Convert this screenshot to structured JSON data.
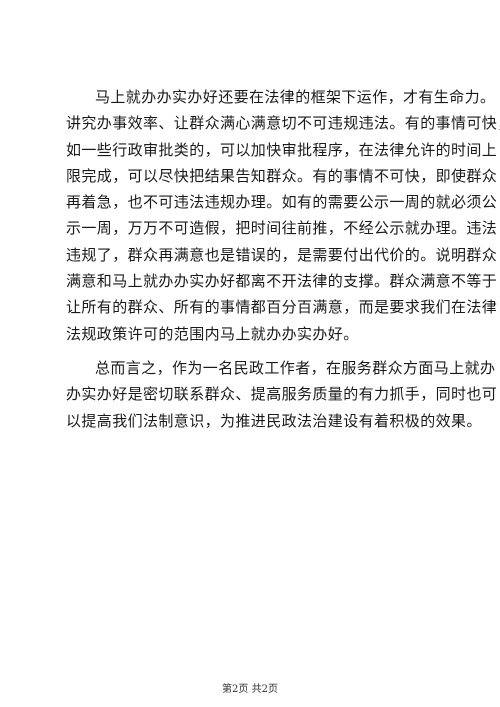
{
  "document": {
    "paragraphs": [
      {
        "lines": [
          "马上就办办实办好还要在法律的框架下运作，才有生命力。",
          "讲究办事效率、让群众满心满意切不可违规违法。有的事情可快，",
          "如一些行政审批类的，可以加快审批程序，在法律允许的时间上",
          "限完成，可以尽快把结果告知群众。有的事情不可快，即使群众",
          "再着急，也不可违法违规办理。如有的需要公示一周的就必须公",
          "示一周，万万不可造假，把时间往前推，不经公示就办理。违法",
          "违规了，群众再满意也是错误的，是需要付出代价的。说明群众",
          "满意和马上就办办实办好都离不开法律的支撑。群众满意不等于",
          "让所有的群众、所有的事情都百分百满意，而是要求我们在法律",
          "法规政策许可的范围内马上就办办实办好。"
        ]
      },
      {
        "lines": [
          "总而言之，作为一名民政工作者，在服务群众方面马上就办",
          "办实办好是密切联系群众、提高服务质量的有力抓手，同时也可",
          "以提高我们法制意识，为推进民政法治建设有着积极的效果。"
        ]
      }
    ]
  },
  "footer": {
    "page_indicator": "第2页 共2页"
  }
}
